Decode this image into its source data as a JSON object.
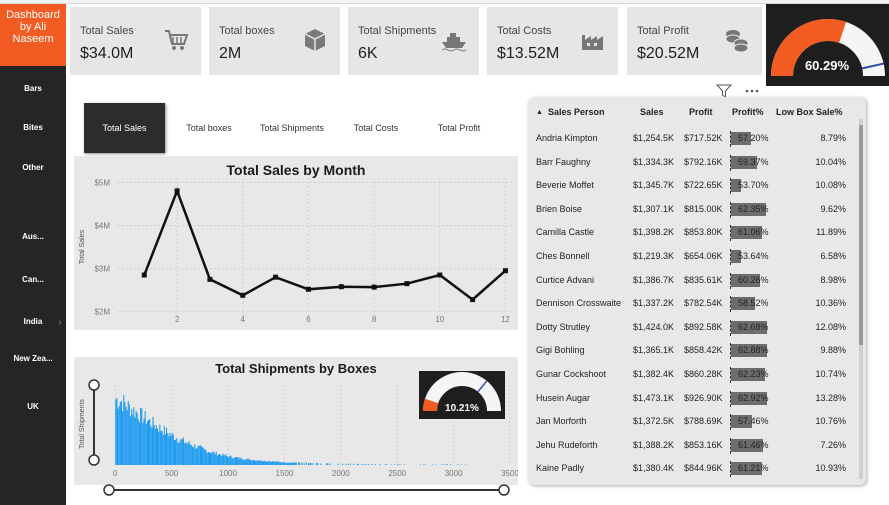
{
  "brand": {
    "line1": "Dashboard",
    "line2": "by Ali",
    "line3": "Naseem"
  },
  "sidebar": {
    "items": [
      {
        "label": "Bars"
      },
      {
        "label": "Bites"
      },
      {
        "label": "Other"
      },
      {
        "label": "Aus..."
      },
      {
        "label": "Can..."
      },
      {
        "label": "India"
      },
      {
        "label": "New Zea..."
      },
      {
        "label": "UK"
      }
    ]
  },
  "kpis": [
    {
      "label": "Total Sales",
      "value": "$34.0M",
      "icon": "shopping-cart-icon"
    },
    {
      "label": "Total boxes",
      "value": "2M",
      "icon": "box-icon"
    },
    {
      "label": "Total Shipments",
      "value": "6K",
      "icon": "ship-icon"
    },
    {
      "label": "Total Costs",
      "value": "$13.52M",
      "icon": "factory-icon"
    },
    {
      "label": "Total Profit",
      "value": "$20.52M",
      "icon": "coins-icon"
    }
  ],
  "gauge_main": {
    "value_text": "60.29%",
    "fraction": 0.6029,
    "target_fraction": 0.93,
    "color": "#f25c23"
  },
  "tabs": [
    {
      "label": "Total Sales",
      "active": true
    },
    {
      "label": "Total boxes",
      "active": false
    },
    {
      "label": "Total Shipments",
      "active": false
    },
    {
      "label": "Total Costs",
      "active": false
    },
    {
      "label": "Total Profit",
      "active": false
    }
  ],
  "line_chart": {
    "title": "Total Sales by Month",
    "ylabel": "Total Sales",
    "yticks": [
      "$5M",
      "$4M",
      "$3M",
      "$2M"
    ],
    "xticks": [
      "2",
      "4",
      "6",
      "8",
      "10",
      "12"
    ]
  },
  "bar_chart": {
    "title": "Total Shipments by Boxes",
    "ylabel": "Total Shipments",
    "xticks": [
      "0",
      "500",
      "1000",
      "1500",
      "2000",
      "2500",
      "3000",
      "3500"
    ],
    "gauge_text": "10.21%",
    "gauge_fraction": 0.1021
  },
  "table": {
    "headers": {
      "person": "Sales Person",
      "sales": "Sales",
      "profit": "Profit",
      "profit_pct": "Profit%",
      "low_box": "Low Box Sale%"
    },
    "rows": [
      {
        "person": "Andria Kimpton",
        "sales": "$1,254.5K",
        "profit": "$717.52K",
        "pct": "57.20%",
        "pct_val": 57.2,
        "low": "8.79%"
      },
      {
        "person": "Barr Faughny",
        "sales": "$1,334.3K",
        "profit": "$792.16K",
        "pct": "59.37%",
        "pct_val": 59.37,
        "low": "10.04%"
      },
      {
        "person": "Beverie Moffet",
        "sales": "$1,345.7K",
        "profit": "$722.65K",
        "pct": "53.70%",
        "pct_val": 53.7,
        "low": "10.08%"
      },
      {
        "person": "Brien Boise",
        "sales": "$1,307.1K",
        "profit": "$815.00K",
        "pct": "62.35%",
        "pct_val": 62.35,
        "low": "9.62%"
      },
      {
        "person": "Camilla Castle",
        "sales": "$1,398.2K",
        "profit": "$853.80K",
        "pct": "61.06%",
        "pct_val": 61.06,
        "low": "11.89%"
      },
      {
        "person": "Ches Bonnell",
        "sales": "$1,219.3K",
        "profit": "$654.06K",
        "pct": "53.64%",
        "pct_val": 53.64,
        "low": "6.58%"
      },
      {
        "person": "Curtice Advani",
        "sales": "$1,386.7K",
        "profit": "$835.61K",
        "pct": "60.26%",
        "pct_val": 60.26,
        "low": "8.98%"
      },
      {
        "person": "Dennison Crosswaite",
        "sales": "$1,337.2K",
        "profit": "$782.54K",
        "pct": "58.52%",
        "pct_val": 58.52,
        "low": "10.36%"
      },
      {
        "person": "Dotty Strutley",
        "sales": "$1,424.0K",
        "profit": "$892.58K",
        "pct": "62.68%",
        "pct_val": 62.68,
        "low": "12.08%"
      },
      {
        "person": "Gigi Bohling",
        "sales": "$1,365.1K",
        "profit": "$858.42K",
        "pct": "62.88%",
        "pct_val": 62.88,
        "low": "9.88%"
      },
      {
        "person": "Gunar Cockshoot",
        "sales": "$1,382.4K",
        "profit": "$860.28K",
        "pct": "62.23%",
        "pct_val": 62.23,
        "low": "10.74%"
      },
      {
        "person": "Husein Augar",
        "sales": "$1,473.1K",
        "profit": "$926.90K",
        "pct": "62.92%",
        "pct_val": 62.92,
        "low": "13.28%"
      },
      {
        "person": "Jan Morforth",
        "sales": "$1,372.5K",
        "profit": "$788.69K",
        "pct": "57.46%",
        "pct_val": 57.46,
        "low": "10.76%"
      },
      {
        "person": "Jehu Rudeforth",
        "sales": "$1,388.2K",
        "profit": "$853.16K",
        "pct": "61.46%",
        "pct_val": 61.46,
        "low": "7.26%"
      },
      {
        "person": "Kaine Padly",
        "sales": "$1,380.4K",
        "profit": "$844.96K",
        "pct": "61.21%",
        "pct_val": 61.21,
        "low": "10.93%"
      }
    ]
  },
  "chart_data": [
    {
      "type": "line",
      "title": "Total Sales by Month",
      "xlabel": "",
      "ylabel": "Total Sales",
      "x": [
        1,
        2,
        3,
        4,
        5,
        6,
        7,
        8,
        9,
        10,
        11,
        12
      ],
      "values": [
        2.85,
        4.8,
        2.75,
        2.38,
        2.8,
        2.52,
        2.58,
        2.57,
        2.65,
        2.85,
        2.28,
        2.95
      ],
      "ylim": [
        1.9,
        5.1
      ],
      "xlim": [
        0.2,
        12.2
      ],
      "unit": "$M"
    },
    {
      "type": "bar",
      "title": "Total Shipments by Boxes",
      "xlabel": "",
      "ylabel": "Total Shipments",
      "xlim": [
        -100,
        3500
      ],
      "note_values_estimated": true,
      "envelope_x": [
        0,
        50,
        100,
        200,
        300,
        400,
        500,
        600,
        700,
        800,
        900,
        1000,
        1200,
        1500,
        2000,
        2500,
        3000,
        3400
      ],
      "envelope_y": [
        1.0,
        0.97,
        0.9,
        0.78,
        0.66,
        0.55,
        0.45,
        0.36,
        0.29,
        0.22,
        0.17,
        0.13,
        0.08,
        0.04,
        0.02,
        0.01,
        0.01,
        0.005
      ]
    }
  ]
}
